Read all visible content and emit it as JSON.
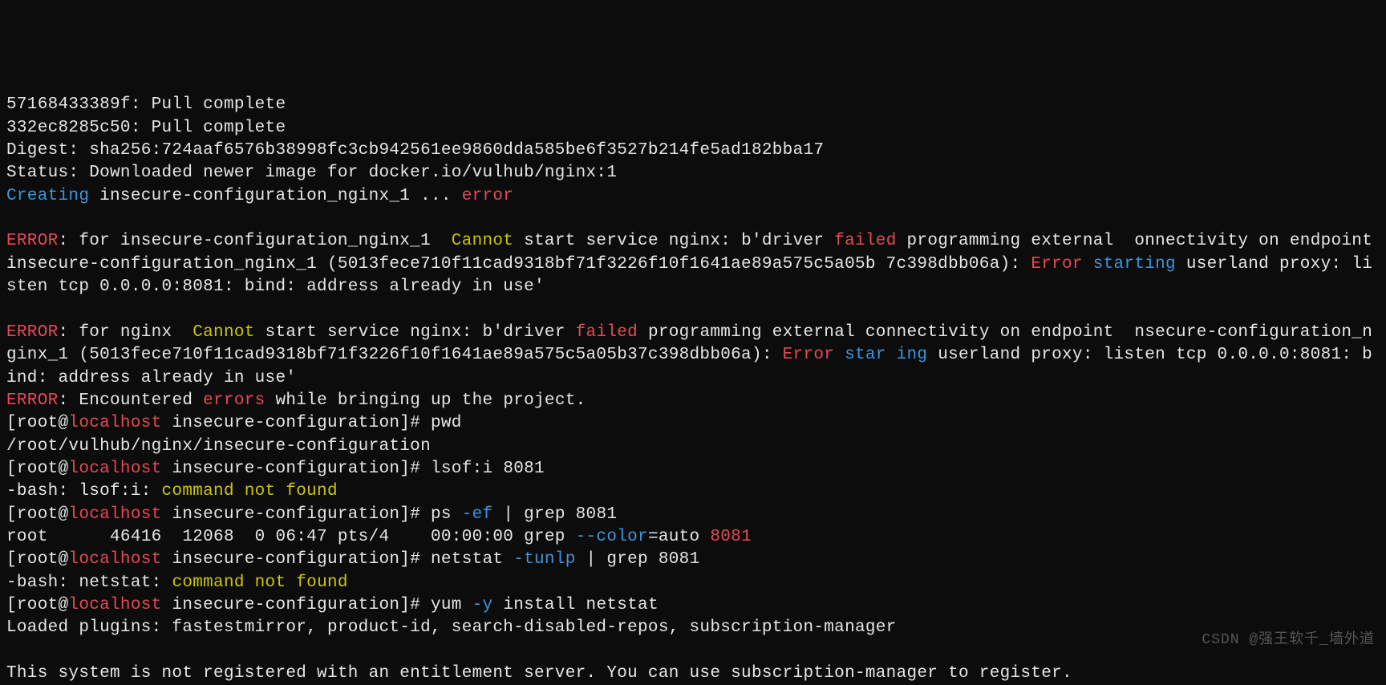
{
  "ln01a": "57168433389f: Pull complete",
  "ln01b": "332ec8285c50: Pull complete",
  "ln02": "Digest: sha256:724aaf6576b38998fc3cb942561ee9860dda585be6f3527b214fe5ad182bba17",
  "ln03": "Status: Downloaded newer image for docker.io/vulhub/nginx:1",
  "ln04_a": "Creating",
  "ln04_b": " insecure-configuration_nginx_1 ... ",
  "ln04_c": "error",
  "blank": "",
  "e1_a": "ERROR",
  "e1_b": ": for insecure-configuration_nginx_1  ",
  "e1_c": "Cannot",
  "e1_d": " start service nginx: b'driver ",
  "e1_e": "failed",
  "e1_f": " programming external  onnectivity on endpoint insecure-configuration_nginx_1 (5013fece710f11cad9318bf71f3226f10f1641ae89a575c5a05b 7c398dbb06a): ",
  "e1_g": "Error",
  "e1_h": " ",
  "e1_i": "starting",
  "e1_j": " userland proxy: listen tcp 0.0.0.0:8081: bind: address already in use'",
  "e2_a": "ERROR",
  "e2_b": ": for nginx  ",
  "e2_c": "Cannot",
  "e2_d": " start service nginx: b'driver ",
  "e2_e": "failed",
  "e2_f": " programming external connectivity on endpoint  nsecure-configuration_nginx_1 (5013fece710f11cad9318bf71f3226f10f1641ae89a575c5a05b37c398dbb06a): ",
  "e2_g": "Error",
  "e2_h": " ",
  "e2_i": "star ing",
  "e2_j": " userland proxy: listen tcp 0.0.0.0:8081: bind: address already in use'",
  "e3_a": "ERROR",
  "e3_b": ": Encountered ",
  "e3_c": "errors",
  "e3_d": " while bringing up the project.",
  "p1_a": "[root@",
  "p1_b": "localhost",
  "p1_c": " insecure-configuration]# ",
  "p1_cmd": "pwd",
  "p1_out": "/root/vulhub/nginx/insecure-configuration",
  "p2_cmd": "lsof:i 8081",
  "p2_out_a": "-bash: lsof:i: ",
  "p2_out_b": "command not found",
  "p3_cmd_a": "ps ",
  "p3_cmd_b": "-ef",
  "p3_cmd_c": " | grep 8081",
  "p3_out_a": "root      46416  12068  0 06:47 pts/4    00:00:00 grep ",
  "p3_out_b": "--color",
  "p3_out_c": "=auto ",
  "p3_out_d": "8081",
  "p4_cmd_a": "netstat ",
  "p4_cmd_b": "-tunlp",
  "p4_cmd_c": " | grep 8081",
  "p4_out_a": "-bash: netstat: ",
  "p4_out_b": "command not found",
  "p5_cmd_a": "yum ",
  "p5_cmd_b": "-y",
  "p5_cmd_c": " install netstat",
  "p5_out": "Loaded plugins: fastestmirror, product-id, search-disabled-repos, subscription-manager",
  "p6_out": "This system is not registered with an entitlement server. You can use subscription-manager to ",
  "p6_tail": "register.",
  "watermark": "CSDN @强王软千_墙外道"
}
